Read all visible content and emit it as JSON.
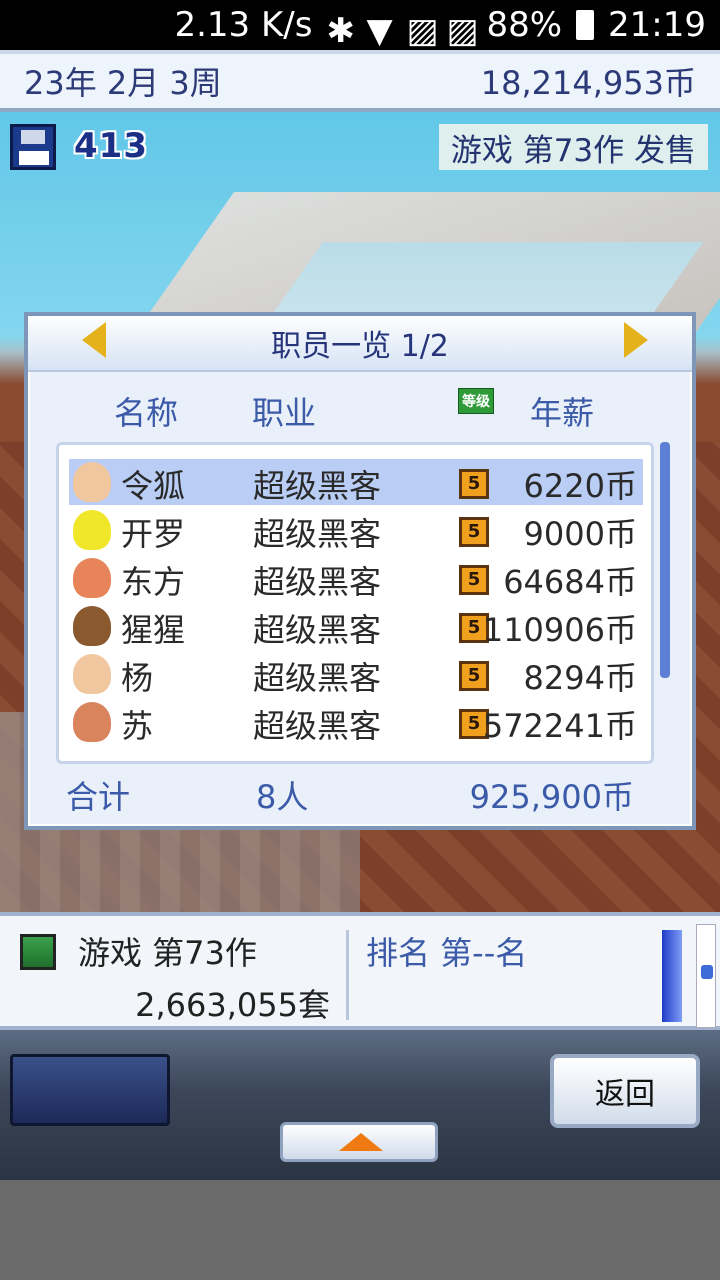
{
  "status_bar": {
    "net_speed": "2.13 K/s",
    "battery": "88%",
    "time": "21:19"
  },
  "top_bar": {
    "date": "23年 2月 3周",
    "money": "18,214,953币"
  },
  "scene": {
    "research_points": "413",
    "release_notice": "游戏 第73作 发售"
  },
  "staff_dialog": {
    "title": "职员一览 1/2",
    "col_name": "名称",
    "col_job": "职业",
    "col_level": "等级",
    "col_salary": "年薪",
    "rows": [
      {
        "name": "令狐",
        "job": "超级黑客",
        "level": "5",
        "salary": "6220币",
        "avatar_color": "#f1c7a0"
      },
      {
        "name": "开罗",
        "job": "超级黑客",
        "level": "5",
        "salary": "9000币",
        "avatar_color": "#f0e62a"
      },
      {
        "name": "东方",
        "job": "超级黑客",
        "level": "5",
        "salary": "64684币",
        "avatar_color": "#e7845a"
      },
      {
        "name": "猩猩",
        "job": "超级黑客",
        "level": "5",
        "salary": "110906币",
        "avatar_color": "#8a5a2e"
      },
      {
        "name": "杨",
        "job": "超级黑客",
        "level": "5",
        "salary": "8294币",
        "avatar_color": "#f1c7a0"
      },
      {
        "name": "苏",
        "job": "超级黑客",
        "level": "5",
        "salary": "572241币",
        "avatar_color": "#d9845c"
      }
    ],
    "total_label": "合计",
    "total_count": "8人",
    "total_salary": "925,900币"
  },
  "sales_panel": {
    "game_title": "游戏 第73作",
    "units_sold": "2,663,055套",
    "rank": "排名 第--名"
  },
  "controls": {
    "back_label": "返回"
  },
  "colors": {
    "accent_blue": "#3b5aa8",
    "selected_row": "#b9cdf5",
    "level_badge": "#f1a01e"
  }
}
